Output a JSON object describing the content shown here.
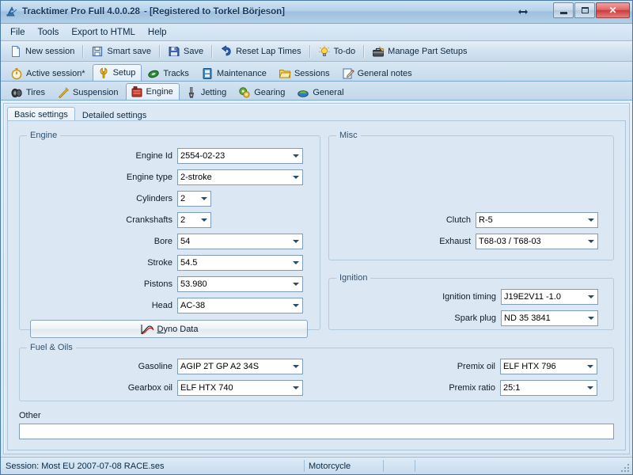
{
  "window": {
    "app_icon": "tracktimer-logo-icon",
    "title": "Tracktimer Pro Full 4.0.0.28",
    "title_registered": "- [Registered to Torkel Börjeson]",
    "drag_hint_icon": "horizontal-resize-icon",
    "buttons": {
      "minimize": "minimize-icon",
      "maximize": "maximize-icon",
      "close": "✕"
    }
  },
  "menubar": {
    "items": [
      {
        "label": "File"
      },
      {
        "label": "Tools"
      },
      {
        "label": "Export to HTML"
      },
      {
        "label": "Help"
      }
    ]
  },
  "toolbar": {
    "items": [
      {
        "label": "New session",
        "icon": "new-document-icon"
      },
      {
        "label": "Smart save",
        "icon": "smart-save-icon"
      },
      {
        "label": "Save",
        "icon": "floppy-disk-icon"
      },
      {
        "label": "Reset Lap Times",
        "icon": "undo-arrow-icon"
      },
      {
        "label": "To-do",
        "icon": "lightbulb-icon"
      },
      {
        "label": "Manage Part Setups",
        "icon": "toolbox-icon"
      }
    ]
  },
  "main_tabs": {
    "selected": "Setup",
    "items": [
      {
        "label": "Active session*",
        "icon": "stopwatch-icon"
      },
      {
        "label": "Setup",
        "icon": "wrench-icon"
      },
      {
        "label": "Tracks",
        "icon": "track-icon"
      },
      {
        "label": "Maintenance",
        "icon": "maintenance-icon"
      },
      {
        "label": "Sessions",
        "icon": "folder-icon"
      },
      {
        "label": "General notes",
        "icon": "notes-pencil-icon"
      }
    ]
  },
  "sub_tabs": {
    "selected": "Engine",
    "items": [
      {
        "label": "Tires",
        "icon": "tire-icon"
      },
      {
        "label": "Suspension",
        "icon": "suspension-icon"
      },
      {
        "label": "Engine",
        "icon": "engine-icon"
      },
      {
        "label": "Jetting",
        "icon": "jetting-icon"
      },
      {
        "label": "Gearing",
        "icon": "gearing-icon"
      },
      {
        "label": "General",
        "icon": "general-icon"
      }
    ]
  },
  "inner_tabs": {
    "selected": "Basic settings",
    "items": [
      {
        "label": "Basic settings"
      },
      {
        "label": "Detailed settings"
      }
    ]
  },
  "groups": {
    "engine": {
      "legend": "Engine",
      "fields": [
        {
          "label": "Engine Id",
          "value": "2554-02-23"
        },
        {
          "label": "Engine type",
          "value": "2-stroke"
        },
        {
          "label": "Cylinders",
          "value": "2"
        },
        {
          "label": "Crankshafts",
          "value": "2"
        },
        {
          "label": "Bore",
          "value": "54"
        },
        {
          "label": "Stroke",
          "value": "54.5"
        },
        {
          "label": "Pistons",
          "value": "53.980"
        },
        {
          "label": "Head",
          "value": "AC-38"
        }
      ],
      "dyno_button": {
        "label_pre": "D",
        "label_post": "yno Data",
        "icon": "dyno-curve-icon"
      }
    },
    "misc": {
      "legend": "Misc",
      "fields": [
        {
          "label": "Clutch",
          "value": "R-5"
        },
        {
          "label": "Exhaust",
          "value": "T68-03 / T68-03"
        }
      ]
    },
    "ignition": {
      "legend": "Ignition",
      "fields": [
        {
          "label": "Ignition timing",
          "value": "J19E2V11 -1.0"
        },
        {
          "label": "Spark plug",
          "value": "ND 35 3841"
        }
      ]
    },
    "fuel_oils": {
      "legend": "Fuel & Oils",
      "fields_left": [
        {
          "label": "Gasoline",
          "value": "AGIP 2T GP A2  34S"
        },
        {
          "label": "Gearbox oil",
          "value": "ELF HTX 740"
        }
      ],
      "fields_right": [
        {
          "label": "Premix oil",
          "value": "ELF HTX 796"
        },
        {
          "label": "Premix ratio",
          "value": "25:1"
        }
      ]
    }
  },
  "other": {
    "label": "Other",
    "value": "",
    "placeholder": ""
  },
  "statusbar": {
    "session": "Session: Most EU 2007-07-08 RACE.ses",
    "vehicle": "Motorcycle",
    "cell3": "",
    "cell4": "",
    "grip_icon": "resize-grip-icon"
  },
  "colors": {
    "frame": "#4a7ba5",
    "title_text": "#17365d",
    "close_button": "#cc3b3b",
    "panel_bg": "#dbe8f4",
    "group_border": "#b4c9d9",
    "field_border": "#7f9db9",
    "legend_text": "#33506b"
  }
}
